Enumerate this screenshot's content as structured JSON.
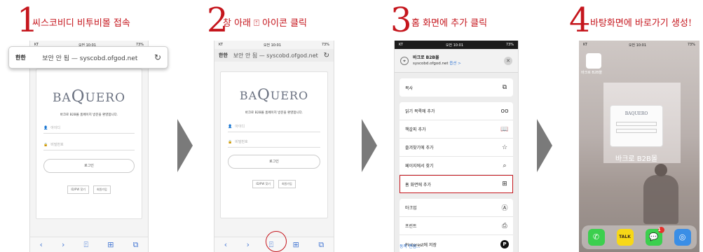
{
  "colors": {
    "accent": "#c5161d",
    "arrow": "#7a7a7a",
    "link": "#3a7bd5"
  },
  "steps": [
    {
      "number": "1",
      "title": "씨스코비디 비투비몰 접속"
    },
    {
      "number": "2",
      "title": "창 아래 ⍐ 아이콘 클릭"
    },
    {
      "number": "3",
      "title": "홈 화면에 추가 클릭"
    },
    {
      "number": "4",
      "title": "바탕화면에 바로가기 생성!"
    }
  ],
  "status": {
    "carrier": "KT",
    "time": "오전 10:01",
    "battery": "73%"
  },
  "browser": {
    "aa": "한한",
    "url_text": "보안 안 됨 — syscobd.ofgod.net",
    "reload_icon": "reload-icon"
  },
  "site": {
    "logo_pre": "BA",
    "logo_q": "Q",
    "logo_post": "UERO",
    "welcome": "바크로 B2B몰 홈페이지 방문을 환영합니다.",
    "id_placeholder": "아이디",
    "pw_placeholder": "비밀번호",
    "login": "로그인",
    "find": "ID/PW 찾기",
    "join": "회원가입"
  },
  "toolbar": {
    "back": "‹",
    "forward": "›",
    "share": "⍐",
    "bookmarks": "⊞",
    "tabs": "⧉"
  },
  "share_sheet": {
    "title": "바크로 B2B몰",
    "subtitle": "syscobd.ofgod.net",
    "options": "옵션 >",
    "close": "✕",
    "copy": {
      "label": "복사",
      "icon": "⧉"
    },
    "group1": [
      {
        "label": "읽기 목록에 추가",
        "icon": "oo"
      },
      {
        "label": "책갈피 추가",
        "icon": "📖"
      },
      {
        "label": "즐겨찾기에 추가",
        "icon": "☆"
      },
      {
        "label": "페이지에서 찾기",
        "icon": "⌕"
      },
      {
        "label": "홈 화면에 추가",
        "icon": "⊞"
      }
    ],
    "group2": [
      {
        "label": "마크업",
        "icon": "Ⓐ"
      },
      {
        "label": "프린트",
        "icon": "⎙"
      },
      {
        "label": "Pinterest에 저장",
        "icon": "P"
      }
    ],
    "edit": "동작 편집..."
  },
  "home": {
    "small_icon_label": "바크로 B2B몰",
    "widget_logo": "BAQUERO",
    "big_icon_label": "바크로 B2B몰",
    "dock": [
      {
        "name": "phone",
        "glyph": "✆",
        "color": "#3ccf4e"
      },
      {
        "name": "kakaotalk",
        "glyph": "TALK",
        "color": "#f7d817"
      },
      {
        "name": "messages",
        "glyph": "💬",
        "color": "#3ccf4e",
        "badge": "1"
      },
      {
        "name": "safari",
        "glyph": "◎",
        "color": "#3a8ee6"
      }
    ]
  }
}
